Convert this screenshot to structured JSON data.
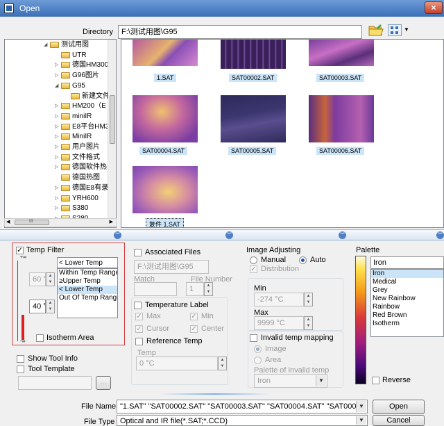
{
  "window": {
    "title": "Open",
    "close_glyph": "×"
  },
  "toolbar": {
    "directory_label": "Directory",
    "directory_value": "F:\\测试用图\\G95",
    "view_menu_arrow": "▼"
  },
  "tree": {
    "items": [
      {
        "label": "测试用图",
        "exp": "◢"
      },
      {
        "label": "UTR",
        "exp": ""
      },
      {
        "label": "德国HM300",
        "exp": "▷"
      },
      {
        "label": "G96图片",
        "exp": "▷"
      },
      {
        "label": "G95",
        "exp": "◢"
      },
      {
        "label": "新建文件",
        "exp": ""
      },
      {
        "label": "HM200（E",
        "exp": "▷"
      },
      {
        "label": "miniIR",
        "exp": "▷"
      },
      {
        "label": "E8平台HM3",
        "exp": "▷"
      },
      {
        "label": "MiniIR",
        "exp": "▷"
      },
      {
        "label": "用户图片",
        "exp": "▷"
      },
      {
        "label": "文件格式",
        "exp": "▷"
      },
      {
        "label": "德国软件热",
        "exp": "▷"
      },
      {
        "label": "德国热图",
        "exp": ""
      },
      {
        "label": "德国E8有录",
        "exp": "▷"
      },
      {
        "label": "YRH600",
        "exp": "▷"
      },
      {
        "label": "S380",
        "exp": "▷"
      },
      {
        "label": "S280",
        "exp": "▷"
      }
    ],
    "hscroll_label": "III",
    "left_arrow": "◀",
    "right_arrow": "▶"
  },
  "thumbnails": [
    {
      "name": "1.SAT"
    },
    {
      "name": "SAT00002.SAT"
    },
    {
      "name": "SAT00003.SAT"
    },
    {
      "name": "SAT00004.SAT"
    },
    {
      "name": "SAT00005.SAT"
    },
    {
      "name": "SAT00006.SAT"
    },
    {
      "name": "复件 1.SAT"
    }
  ],
  "collapse_glyph": "︾",
  "temp_filter": {
    "label": "Temp Filter",
    "checked": "✓",
    "scale_top": "+∞",
    "scale_bottom": "-∞",
    "upper_value": "60 °C",
    "lower_value": "40 °C",
    "selected_option": "< Lower Temp",
    "options": [
      "Within Temp Range",
      "≥Upper Temp",
      "< Lower Temp",
      "Out Of Temp Range"
    ],
    "isotherm_label": "Isotherm Area"
  },
  "associated": {
    "label": "Associated Files",
    "path_value": "F:\\测试用图\\G95",
    "match_label": "Match",
    "file_number_label": "File Number",
    "file_number_value": "1"
  },
  "temperature_label": {
    "label": "Temperature Label",
    "max_label": "Max",
    "min_label": "Min",
    "cursor_label": "Cursor",
    "center_label": "Center",
    "reference_label": "Reference Temp",
    "temp_label": "Temp",
    "temp_value": "0 °C"
  },
  "image_adjusting": {
    "label": "Image Adjusting",
    "manual_label": "Manual",
    "auto_label": "Auto",
    "distribution_label": "Distribution",
    "min_label": "Min",
    "min_value": "-274 °C",
    "max_label": "Max",
    "max_value": "9999 °C"
  },
  "invalid_mapping": {
    "label": "Invalid temp mapping",
    "image_label": "Image",
    "area_label": "Area",
    "palette_label": "Palette of invalid temp",
    "palette_value": "Iron"
  },
  "palette": {
    "label": "Palette",
    "selected": "Iron",
    "options": [
      "Iron",
      "Medical",
      "Grey",
      "New Rainbow",
      "Rainbow",
      "Red Brown",
      "Isotherm"
    ],
    "reverse_label": "Reverse"
  },
  "tool_info": {
    "label": "Show Tool Info"
  },
  "tool_template": {
    "label": "Tool Template",
    "browse_label": "..."
  },
  "footer": {
    "file_name_label": "File Name",
    "file_name_value": "\"1.SAT\" \"SAT00002.SAT\" \"SAT00003.SAT\" \"SAT00004.SAT\" \"SAT00005.SAT\" \"SAT",
    "file_type_label": "File Type",
    "file_type_value": "Optical and IR file(*.SAT;*.CCD)",
    "open_button": "Open",
    "cancel_button": "Cancel"
  },
  "colors": {
    "accent": "#3a6fb8",
    "filter_box_border": "#d04040",
    "selection": "#cce4f7"
  },
  "icons": [
    "open-folder-icon",
    "view-menu-icon",
    "folder-icon",
    "close-icon",
    "collapse-chevron-icon"
  ]
}
